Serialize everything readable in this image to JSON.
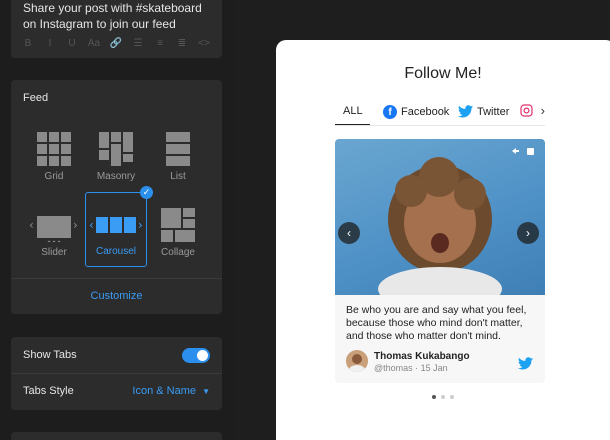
{
  "editor": {
    "text": "Share your post with #skateboard on Instagram to join our feed",
    "toolbar": [
      "B",
      "I",
      "U",
      "Aa",
      "🔗",
      "☰",
      "≡",
      "≣",
      "<>"
    ]
  },
  "feed": {
    "title": "Feed",
    "layouts": [
      {
        "label": "Grid",
        "selected": false
      },
      {
        "label": "Masonry",
        "selected": false
      },
      {
        "label": "List",
        "selected": false
      },
      {
        "label": "Slider",
        "selected": false
      },
      {
        "label": "Carousel",
        "selected": true
      },
      {
        "label": "Collage",
        "selected": false
      }
    ],
    "customize_label": "Customize"
  },
  "tabs_settings": {
    "show_tabs_label": "Show Tabs",
    "show_tabs_on": true,
    "tabs_style_label": "Tabs Style",
    "tabs_style_value": "Icon & Name"
  },
  "preview": {
    "title": "Follow Me!",
    "tabs": [
      {
        "label": "ALL",
        "active": true
      },
      {
        "label": "Facebook",
        "icon": "facebook-icon"
      },
      {
        "label": "Twitter",
        "icon": "twitter-icon"
      }
    ],
    "post": {
      "caption": "Be who you are and say what you feel, because those who mind don't matter, and those who matter don't mind.",
      "author": "Thomas Kukabango",
      "handle_date": "@thomas · 15 Jan"
    },
    "carousel_total": 3,
    "carousel_active": 1
  },
  "colors": {
    "accent": "#2b8fee",
    "panel_bg": "#2c2c2c",
    "page_bg": "#1e1e1e",
    "twitter": "#1da1f2",
    "facebook": "#1877f2"
  }
}
